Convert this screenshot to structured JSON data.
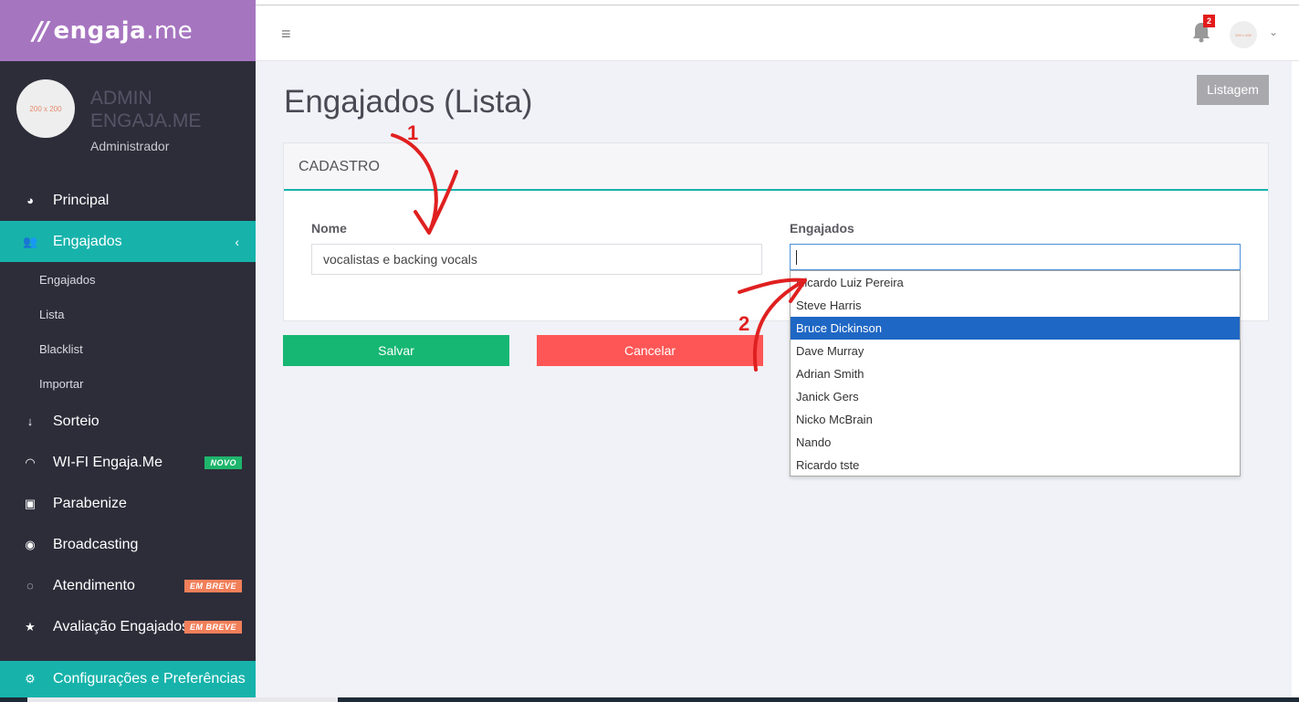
{
  "brand": {
    "name_bold": "engaja",
    "name_light": ".me"
  },
  "profile": {
    "avatar_text": "200 x 200",
    "name": "ADMIN ENGAJA.ME",
    "role": "Administrador"
  },
  "sidebar": {
    "items": [
      {
        "label": "Principal",
        "icon": "dashboard-icon"
      },
      {
        "label": "Engajados",
        "icon": "users-icon",
        "chevron": "‹"
      },
      {
        "label": "Sorteio",
        "icon": "sort-numeric-icon"
      },
      {
        "label": "WI-FI Engaja.Me",
        "icon": "wifi-icon",
        "badge": "NOVO"
      },
      {
        "label": "Parabenize",
        "icon": "gift-icon"
      },
      {
        "label": "Broadcasting",
        "icon": "compass-icon"
      },
      {
        "label": "Atendimento",
        "icon": "chat-icon",
        "badge": "EM BREVE"
      },
      {
        "label": "Avaliação Engajados",
        "icon": "star-icon",
        "badge": "EM BREVE"
      },
      {
        "label": "Configurações e Preferências",
        "icon": "gear-icon"
      }
    ],
    "sub_items": [
      "Engajados",
      "Lista",
      "Blacklist",
      "Importar"
    ]
  },
  "topbar": {
    "notification_count": "2",
    "avatar_text": "200 x 200"
  },
  "page": {
    "title": "Engajados (Lista)",
    "list_button": "Listagem"
  },
  "card": {
    "header": "CADASTRO",
    "nome_label": "Nome",
    "nome_value": "vocalistas e  backing vocals",
    "engajados_label": "Engajados",
    "engajados_value": ""
  },
  "dropdown": {
    "options": [
      "Ricardo Luiz Pereira",
      "Steve Harris",
      "Bruce Dickinson",
      "Dave Murray",
      "Adrian Smith",
      "Janick Gers",
      "Nicko McBrain",
      "Nando",
      "Ricardo tste"
    ],
    "selected": "Bruce Dickinson"
  },
  "actions": {
    "save": "Salvar",
    "cancel": "Cancelar"
  },
  "annotations": {
    "step1": "1",
    "step2": "2",
    "color": "#e02020"
  },
  "colors": {
    "brand": "#a675c0",
    "sidebar": "#2d2d3a",
    "accent": "#17b3ab",
    "save": "#16b773",
    "cancel": "#fe5656",
    "selected": "#1f67c4"
  }
}
